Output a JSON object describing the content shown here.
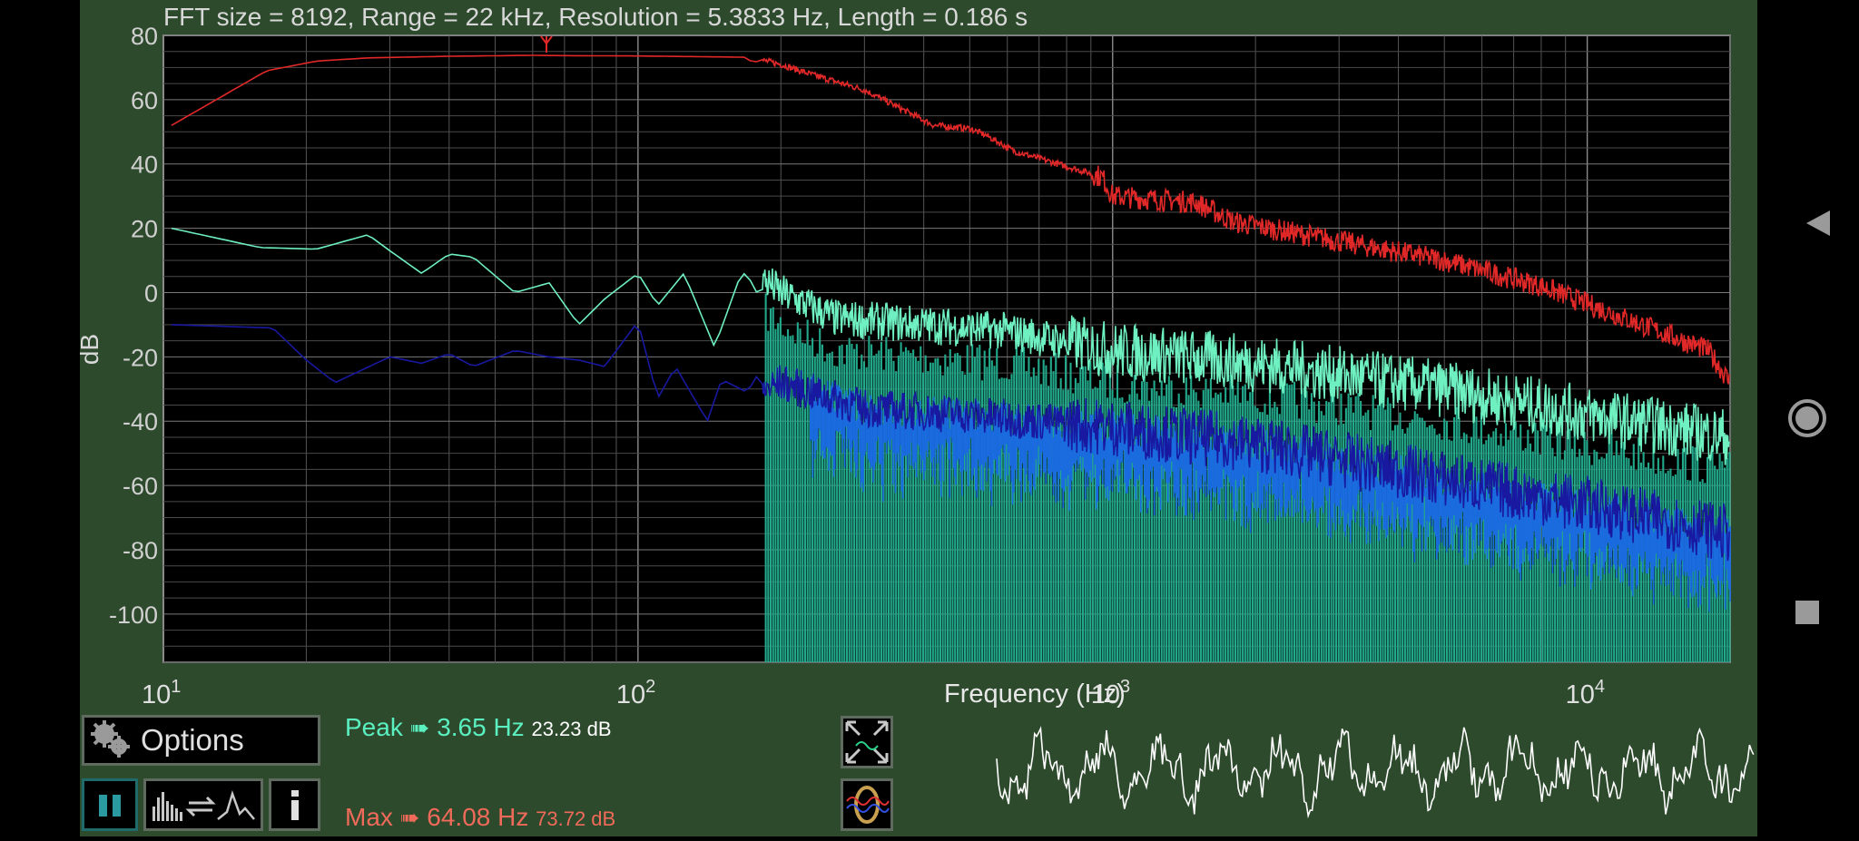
{
  "header": {
    "info_text": "FFT size = 8192, Range = 22 kHz, Resolution = 5.3833 Hz, Length = 0.186 s"
  },
  "chart_data": {
    "type": "line",
    "xlabel": "Frequency (Hz)",
    "ylabel": "dB",
    "x_scale": "log",
    "xlim": [
      10,
      20000
    ],
    "ylim": [
      -115,
      80
    ],
    "grid": true,
    "x_tick_labels": [
      {
        "base": "10",
        "exp": "1"
      },
      {
        "base": "10",
        "exp": "2"
      },
      {
        "base": "10",
        "exp": "3"
      },
      {
        "base": "10",
        "exp": "4"
      }
    ],
    "y_ticks": [
      "80",
      "60",
      "40",
      "20",
      "0",
      "-20",
      "-40",
      "-60",
      "-80",
      "-100"
    ],
    "series": [
      {
        "color": "#e02828",
        "x": [
          10.4,
          16.5,
          21,
          27,
          40,
          60,
          70,
          100,
          170,
          200,
          230,
          300,
          420,
          500,
          540,
          620,
          950,
          1000,
          1500,
          1800,
          3000,
          5000,
          8000,
          12000,
          18000,
          20000
        ],
        "y": [
          52,
          69,
          72,
          73,
          73.5,
          73.8,
          73.7,
          73.6,
          73.2,
          71,
          68,
          63,
          52,
          51,
          49,
          44,
          36,
          30,
          28,
          22,
          16,
          10,
          2,
          -8,
          -18,
          -28
        ]
      },
      {
        "color": "#6ef0c0",
        "x": [
          10.4,
          16,
          21,
          27,
          30,
          35,
          40,
          45,
          55,
          65,
          75,
          85,
          100,
          110,
          125,
          145,
          165,
          180,
          200,
          260,
          400,
          600,
          1000,
          2000,
          5000,
          10000,
          20000
        ],
        "y": [
          20,
          14,
          13.5,
          18,
          13,
          6,
          12,
          11,
          0,
          3,
          -10,
          -2,
          6,
          -4,
          6,
          -17,
          6,
          5,
          0,
          -8,
          -10,
          -12,
          -18,
          -22,
          -30,
          -38,
          -45
        ]
      },
      {
        "color": "#1818a0",
        "x": [
          10.4,
          17,
          20,
          23,
          30,
          35,
          40,
          45,
          55,
          65,
          75,
          85,
          100,
          110,
          120,
          140,
          150,
          175,
          200,
          300,
          500,
          1000,
          2000,
          5000,
          10000,
          20000
        ],
        "y": [
          -10,
          -11,
          -21,
          -28,
          -20,
          -22,
          -19,
          -23,
          -18,
          -20,
          -21,
          -23,
          -9,
          -33,
          -23,
          -40,
          -27,
          -32,
          -28,
          -36,
          -38,
          -42,
          -47,
          -58,
          -66,
          -75
        ]
      }
    ]
  },
  "spectrum_fill": {
    "color": "#22a88a",
    "start_hz": 185,
    "top_db": [
      -4,
      -10,
      -14,
      -20,
      -24,
      -30,
      -34,
      -40
    ]
  },
  "controls": {
    "options_label": "Options"
  },
  "readouts": {
    "peak": {
      "label": "Peak",
      "freq": "3.65 Hz",
      "db": "23.23 dB",
      "color": "#5af0c0"
    },
    "max": {
      "label": "Max",
      "freq": "64.08 Hz",
      "db": "73.72 dB",
      "color": "#f06a5a"
    }
  },
  "icons": {
    "expand": "expand-icon",
    "waveform_toggle": "waveform-toggle-icon",
    "pause": "pause-icon",
    "spectrum_mode": "spectrum-mode-icon",
    "info": "info-icon",
    "gear": "gear-icon"
  },
  "nav": {
    "back": "back-icon",
    "home": "home-icon",
    "recents": "recents-icon"
  }
}
